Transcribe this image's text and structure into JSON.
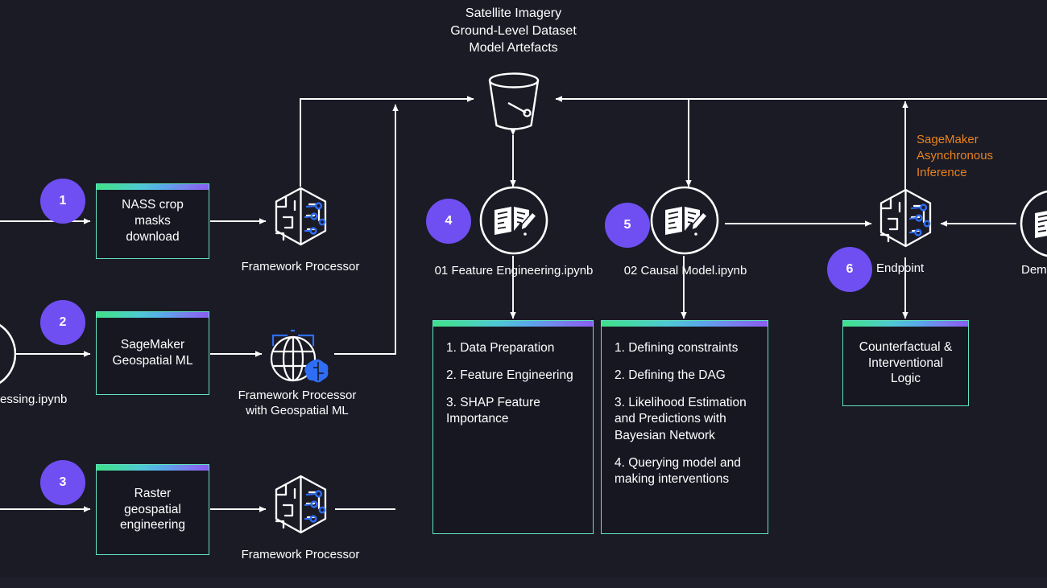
{
  "diagram": {
    "title_block": "Satellite Imagery\nGround-Level Dataset\nModel Artefacts",
    "bucket_icon": "s3-bucket-icon",
    "background_color": "#1b1b26",
    "accent_border_color": "#5fe3c0",
    "badge_color": "#6f4ff2",
    "orange_color": "#e8821e",
    "gradient_colors": [
      "#3fe08a",
      "#4fc8d6",
      "#8a5cf2"
    ]
  },
  "steps": [
    {
      "number": "1"
    },
    {
      "number": "2"
    },
    {
      "number": "3"
    },
    {
      "number": "4"
    },
    {
      "number": "5"
    },
    {
      "number": "6"
    }
  ],
  "boxes": [
    {
      "id": "nass",
      "text": "NASS crop masks\ndownload"
    },
    {
      "id": "geospatial",
      "text": "SageMaker\nGeospatial ML"
    },
    {
      "id": "raster",
      "text": "Raster\ngeospatial\nengineering"
    },
    {
      "id": "counterfactual",
      "text": "Counterfactual &\nInterventional\nLogic"
    }
  ],
  "list_boxes": [
    {
      "id": "feature-engineering-steps",
      "items": [
        "1. Data Preparation",
        "2. Feature Engineering",
        "3. SHAP Feature\nImportance"
      ]
    },
    {
      "id": "causal-model-steps",
      "items": [
        "1. Defining constraints",
        "2. Defining the DAG",
        "3. Likelihood Estimation\nand Predictions with\nBayesian Network",
        "4. Querying model and\nmaking interventions"
      ]
    }
  ],
  "captions": [
    {
      "id": "processor-1",
      "text": "Framework Processor"
    },
    {
      "id": "processor-geospatial",
      "text": "Framework Processor\nwith Geospatial ML"
    },
    {
      "id": "processor-3",
      "text": "Framework Processor"
    },
    {
      "id": "notebook-01",
      "text": "01 Feature Engineering.ipynb"
    },
    {
      "id": "notebook-02",
      "text": "02 Causal Model.ipynb"
    },
    {
      "id": "endpoint",
      "text": "Endpoint"
    },
    {
      "id": "notebook-00",
      "text": "essing.ipynb"
    },
    {
      "id": "notebook-demo",
      "text": "Dem"
    }
  ],
  "annotations": [
    {
      "id": "async-inference",
      "text": "SageMaker\nAsynchronous\nInference",
      "color": "#e8821e"
    }
  ]
}
